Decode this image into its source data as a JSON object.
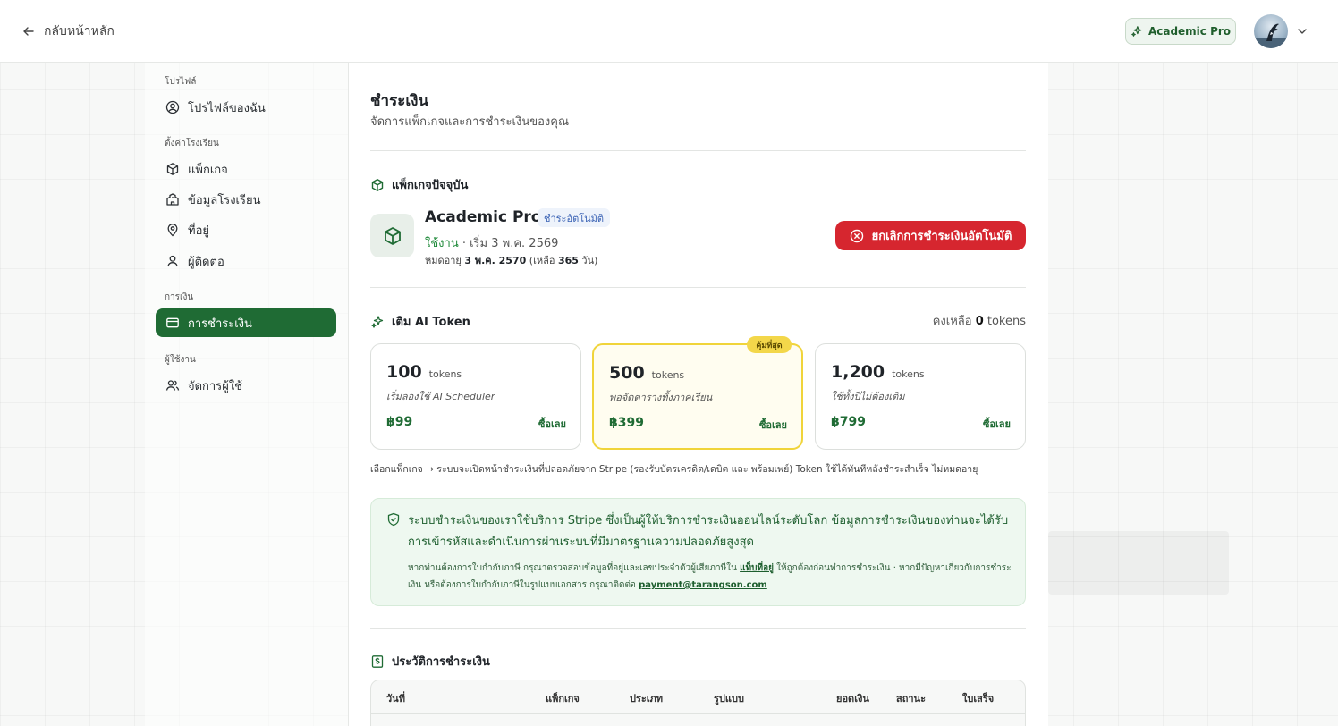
{
  "topbar": {
    "back_label": "กลับหน้าหลัก",
    "plan_label": "Academic Pro"
  },
  "sidebar": {
    "sections": [
      {
        "label": "โปรไฟล์",
        "items": [
          {
            "label": "โปรไฟล์ของฉัน",
            "icon": "user-circle-icon"
          }
        ]
      },
      {
        "label": "ตั้งค่าโรงเรียน",
        "items": [
          {
            "label": "แพ็กเกจ",
            "icon": "package-icon"
          },
          {
            "label": "ข้อมูลโรงเรียน",
            "icon": "school-icon"
          },
          {
            "label": "ที่อยู่",
            "icon": "map-pin-icon"
          },
          {
            "label": "ผู้ติดต่อ",
            "icon": "user-icon"
          }
        ]
      },
      {
        "label": "การเงิน",
        "items": [
          {
            "label": "การชำระเงิน",
            "icon": "credit-card-icon",
            "active": true
          }
        ]
      },
      {
        "label": "ผู้ใช้งาน",
        "items": [
          {
            "label": "จัดการผู้ใช้",
            "icon": "users-icon"
          }
        ]
      }
    ]
  },
  "main": {
    "title": "ชำระเงิน",
    "subtitle": "จัดการแพ็กเกจและการชำระเงินของคุณ",
    "current_package": {
      "heading": "แพ็กเกจปัจจุบัน",
      "name": "Academic Pro",
      "badge": "ชำระอัตโนมัติ",
      "status": "ใช้งาน",
      "start": " · เริ่ม 3 พ.ค. 2569",
      "expiry_prefix": "หมดอายุ ",
      "expiry_date": "3 พ.ค. 2570",
      "expiry_mid": " (เหลือ ",
      "days_left": "365",
      "expiry_suffix": " วัน)",
      "cancel_label": "ยกเลิกการชำระเงินอัตโนมัติ"
    },
    "ai_tokens": {
      "heading": "เติม AI Token",
      "remaining_prefix": "คงเหลือ ",
      "remaining": "0",
      "remaining_suffix": " tokens",
      "best_tag": "คุ้มที่สุด",
      "packs": [
        {
          "amount": "100",
          "unit": "tokens",
          "desc": "เริ่มลองใช้ AI Scheduler",
          "price": "฿99",
          "buy": "ซื้อเลย"
        },
        {
          "amount": "500",
          "unit": "tokens",
          "desc": "พอจัดตารางทั้งภาคเรียน",
          "price": "฿399",
          "buy": "ซื้อเลย"
        },
        {
          "amount": "1,200",
          "unit": "tokens",
          "desc": "ใช้ทั้งปีไม่ต้องเติม",
          "price": "฿799",
          "buy": "ซื้อเลย"
        }
      ],
      "note": "เลือกแพ็กเกจ → ระบบจะเปิดหน้าชำระเงินที่ปลอดภัยจาก Stripe (รองรับบัตรเครดิต/เดบิต และ พร้อมเพย์) Token ใช้ได้ทันทีหลังชำระสำเร็จ ไม่หมดอายุ"
    },
    "security": {
      "main_text": "ระบบชำระเงินของเราใช้บริการ Stripe ซึ่งเป็นผู้ให้บริการชำระเงินออนไลน์ระดับโลก ข้อมูลการชำระเงินของท่านจะได้รับการเข้ารหัสและดำเนินการผ่านระบบที่มีมาตรฐานความปลอดภัยสูงสุด",
      "sub_prefix": "หากท่านต้องการใบกำกับภาษี กรุณาตรวจสอบข้อมูลที่อยู่และเลขประจำตัวผู้เสียภาษีใน ",
      "address_link": "แท็บที่อยู่",
      "sub_mid": " ให้ถูกต้องก่อนทำการชำระเงิน · หากมีปัญหาเกี่ยวกับการชำระเงิน หรือต้องการใบกำกับภาษีในรูปแบบเอกสาร กรุณาติดต่อ ",
      "email": "payment@tarangson.com"
    },
    "history": {
      "heading": "ประวัติการชำระเงิน",
      "columns": [
        "วันที่",
        "แพ็กเกจ",
        "ประเภท",
        "รูปแบบ",
        "ยอดเงิน",
        "สถานะ",
        "ใบเสร็จ"
      ]
    }
  },
  "colors": {
    "brand_green": "#1f6b34",
    "danger": "#d6262f",
    "best_yellow": "#f3d74a"
  }
}
